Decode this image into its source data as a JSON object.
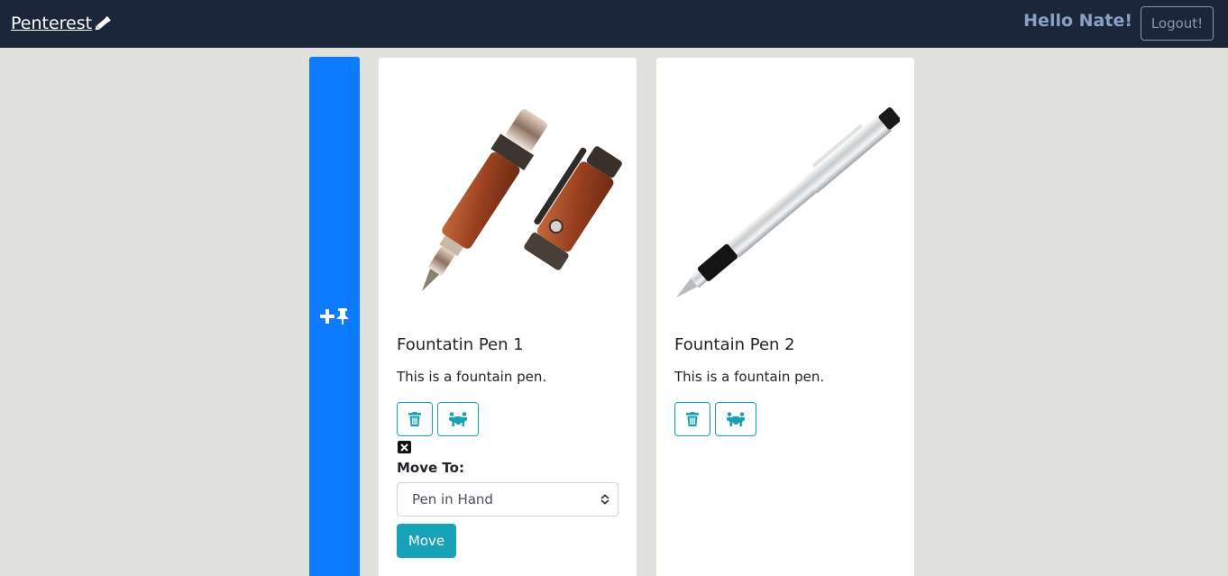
{
  "navbar": {
    "brand": "Penterest",
    "greeting": "Hello Nate!",
    "logout_label": "Logout!"
  },
  "board": {
    "add_pin_icon": "plus-pin-icon",
    "pins": [
      {
        "title": "Fountatin Pen 1",
        "description": "This is a fountain pen.",
        "image": "wood-fountain-pen",
        "move_form": {
          "label": "Move To:",
          "selected_board": "Pen in Hand",
          "submit_label": "Move"
        }
      },
      {
        "title": "Fountain Pen 2",
        "description": "This is a fountain pen.",
        "image": "silver-fountain-pen"
      }
    ]
  },
  "colors": {
    "navbar_bg": "#1c263b",
    "page_bg": "#e0e0dc",
    "primary": "#0d7bff",
    "info": "#17a2b8"
  }
}
